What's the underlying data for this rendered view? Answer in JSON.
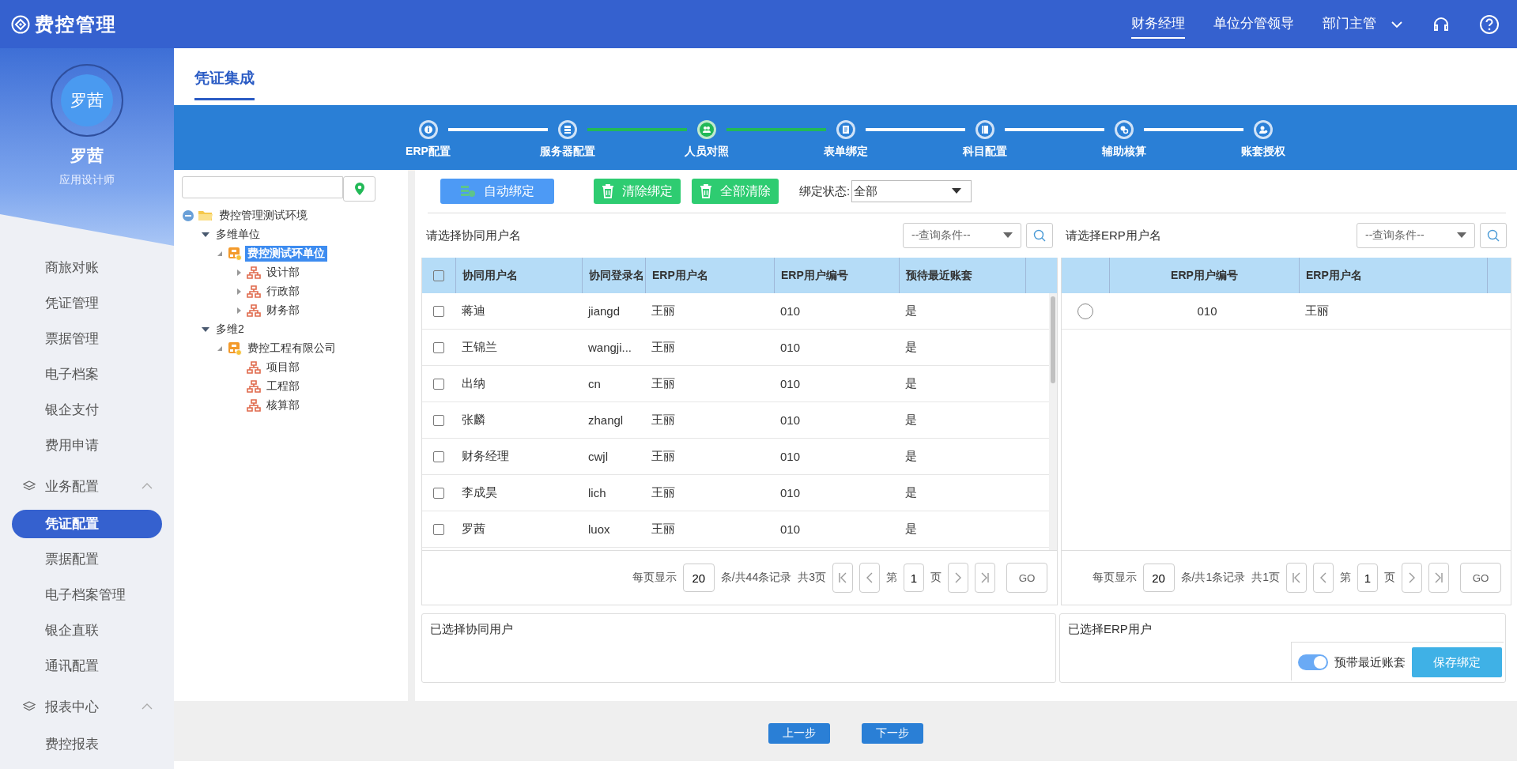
{
  "app": {
    "title": "费控管理"
  },
  "header_nav": [
    {
      "label": "财务经理",
      "selected": true,
      "dropdown": false
    },
    {
      "label": "单位分管领导",
      "selected": false,
      "dropdown": false
    },
    {
      "label": "部门主管",
      "selected": false,
      "dropdown": true
    }
  ],
  "user": {
    "avatar_text": "罗茜",
    "name": "罗茜",
    "role": "应用设计师"
  },
  "sidebar": {
    "items": [
      {
        "kind": "item",
        "label": "商旅对账",
        "selected": false
      },
      {
        "kind": "item",
        "label": "凭证管理",
        "selected": false
      },
      {
        "kind": "item",
        "label": "票据管理",
        "selected": false
      },
      {
        "kind": "item",
        "label": "电子档案",
        "selected": false
      },
      {
        "kind": "item",
        "label": "银企支付",
        "selected": false
      },
      {
        "kind": "item",
        "label": "费用申请",
        "selected": false
      },
      {
        "kind": "group",
        "label": "业务配置",
        "expanded": true
      },
      {
        "kind": "item",
        "label": "凭证配置",
        "selected": true
      },
      {
        "kind": "item",
        "label": "票据配置",
        "selected": false
      },
      {
        "kind": "item",
        "label": "电子档案管理",
        "selected": false
      },
      {
        "kind": "item",
        "label": "银企直联",
        "selected": false
      },
      {
        "kind": "item",
        "label": "通讯配置",
        "selected": false
      },
      {
        "kind": "group",
        "label": "报表中心",
        "expanded": true
      },
      {
        "kind": "item",
        "label": "费控报表",
        "selected": false
      }
    ]
  },
  "tabs": [
    {
      "label": "凭证集成",
      "selected": true
    }
  ],
  "steps": [
    {
      "label": "ERP配置",
      "selected": false
    },
    {
      "label": "服务器配置",
      "selected": false
    },
    {
      "label": "人员对照",
      "selected": true
    },
    {
      "label": "表单绑定",
      "selected": false
    },
    {
      "label": "科目配置",
      "selected": false
    },
    {
      "label": "辅助核算",
      "selected": false
    },
    {
      "label": "账套授权",
      "selected": false
    }
  ],
  "tree": {
    "nodes": [
      {
        "kind": "folder",
        "label": "费控管理测试环境",
        "expanded": true,
        "selected": false,
        "children": [
          {
            "kind": "group",
            "label": "多维单位",
            "expanded": true,
            "selected": false,
            "children": [
              {
                "kind": "unit",
                "label": "费控测试环单位",
                "expanded": true,
                "selected": true,
                "children": [
                  {
                    "kind": "dept",
                    "label": "设计部",
                    "expanded": false,
                    "selected": false
                  },
                  {
                    "kind": "dept",
                    "label": "行政部",
                    "expanded": false,
                    "selected": false
                  },
                  {
                    "kind": "dept",
                    "label": "财务部",
                    "expanded": false,
                    "selected": false
                  }
                ]
              }
            ]
          },
          {
            "kind": "group",
            "label": "多维2",
            "expanded": true,
            "selected": false,
            "children": [
              {
                "kind": "unit",
                "label": "费控工程有限公司",
                "expanded": true,
                "selected": false,
                "children": [
                  {
                    "kind": "dept",
                    "label": "项目部",
                    "selected": false
                  },
                  {
                    "kind": "dept",
                    "label": "工程部",
                    "selected": false
                  },
                  {
                    "kind": "dept",
                    "label": "核算部",
                    "selected": false
                  }
                ]
              }
            ]
          }
        ]
      }
    ]
  },
  "toolbar": {
    "buttons": [
      {
        "kind": "primary",
        "label": "自动绑定"
      },
      {
        "kind": "danger",
        "label": "清除绑定"
      },
      {
        "kind": "danger",
        "label": "全部清除"
      }
    ],
    "status_filter": {
      "label": "绑定状态:",
      "value": "全部"
    }
  },
  "left_panel": {
    "title": "请选择协同用户名",
    "query": {
      "placeholder": "--查询条件--"
    },
    "table": {
      "all_checked": false,
      "columns": [
        "协同用户名",
        "协同登录名",
        "ERP用户名",
        "ERP用户编号",
        "预待最近账套"
      ],
      "rows": [
        {
          "checked": false,
          "cells": [
            "蒋迪",
            "jiangd",
            "王丽",
            "010",
            "是"
          ]
        },
        {
          "checked": false,
          "cells": [
            "王锦兰",
            "wangji...",
            "王丽",
            "010",
            "是"
          ]
        },
        {
          "checked": false,
          "cells": [
            "出纳",
            "cn",
            "王丽",
            "010",
            "是"
          ]
        },
        {
          "checked": false,
          "cells": [
            "张麟",
            "zhangl",
            "王丽",
            "010",
            "是"
          ]
        },
        {
          "checked": false,
          "cells": [
            "财务经理",
            "cwjl",
            "王丽",
            "010",
            "是"
          ]
        },
        {
          "checked": false,
          "cells": [
            "李成昊",
            "lich",
            "王丽",
            "010",
            "是"
          ]
        },
        {
          "checked": false,
          "cells": [
            "罗茜",
            "luox",
            "王丽",
            "010",
            "是"
          ]
        }
      ]
    },
    "pager": {
      "per_page_label": "每页显示",
      "per_page": "20",
      "records": "条/共44条记录",
      "pages": "共3页",
      "page_prefix": "第",
      "page": "1",
      "page_suffix": "页",
      "go": "GO"
    }
  },
  "right_panel": {
    "title": "请选择ERP用户名",
    "query": {
      "placeholder": "--查询条件--"
    },
    "table": {
      "columns": [
        "ERP用户编号",
        "ERP用户名"
      ],
      "rows": [
        {
          "selected": false,
          "cells": [
            "010",
            "王丽"
          ]
        }
      ]
    },
    "pager": {
      "per_page_label": "每页显示",
      "per_page": "20",
      "records": "条/共1条记录",
      "pages": "共1页",
      "page_prefix": "第",
      "page": "1",
      "page_suffix": "页",
      "go": "GO"
    }
  },
  "selected_users": {
    "label": "已选择协同用户"
  },
  "selected_erp": {
    "label": "已选择ERP用户",
    "toggle": {
      "label": "预带最近账套",
      "on": true
    },
    "save_button": "保存绑定"
  },
  "footer_buttons": [
    "上一步",
    "下一步"
  ]
}
